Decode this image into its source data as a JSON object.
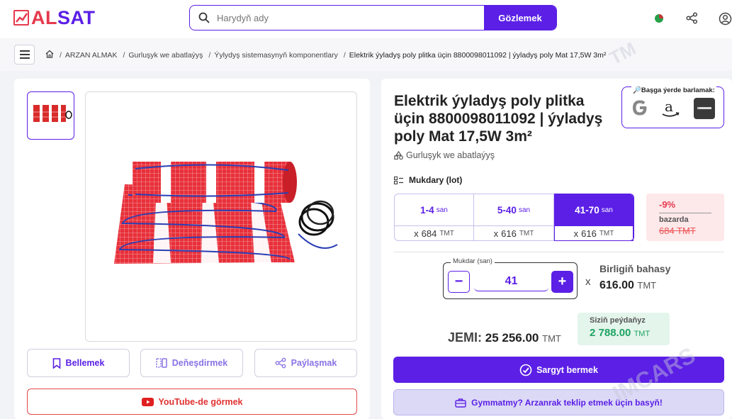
{
  "header": {
    "logo_text": "ALSAT",
    "search_placeholder": "Harydyň ady",
    "search_button": "Gözlemek"
  },
  "breadcrumb": {
    "items": [
      "ARZAN ALMAK",
      "Gurluşyk we abatlaýyş",
      "Ýylydyş sistemasynyň komponentlary"
    ],
    "current": "Elektrik ýyladyş poly plitka üçin 8800098011092 | ýyladyş poly Mat 17,5W 3m²"
  },
  "product": {
    "title": "Elektrik ýyladyş poly plitka üçin 8800098011092 | ýyladyş poly Mat 17,5W 3m²",
    "category": "Gurluşyk we abatlaýyş"
  },
  "compare": {
    "label": "🔎Başga ýerde barlamak:"
  },
  "actions": {
    "bookmark": "Bellemek",
    "compare": "Deňeşdirmek",
    "share": "Paýlaşmak",
    "youtube": "YouTube-de görmek"
  },
  "quantity": {
    "label": "Mukdary (lot)",
    "tiers": [
      {
        "range": "1-4",
        "unit": "san",
        "prefix": "x",
        "price": "684",
        "currency": "TMT"
      },
      {
        "range": "5-40",
        "unit": "san",
        "prefix": "x",
        "price": "616",
        "currency": "TMT"
      },
      {
        "range": "41-70",
        "unit": "san",
        "prefix": "x",
        "price": "616",
        "currency": "TMT"
      }
    ],
    "discount": {
      "percent": "-9%",
      "label": "bazarda",
      "old_price": "684 TMT"
    },
    "field_label": "Mukdar (san)",
    "value": "41",
    "minus": "−",
    "plus": "+",
    "times": "x",
    "unit_price_label": "Birligiň bahasy",
    "unit_price": "616.00",
    "currency": "TMT"
  },
  "summary": {
    "total_label": "JEMI:",
    "total": "25 256.00",
    "savings_label": "Siziň peýdaňyz",
    "savings": "2 788.00",
    "currency": "TMT"
  },
  "cta": {
    "order": "Sargyt bermek",
    "offer": "Gymmatmy? Arzanrak teklip etmek üçin basyň!"
  },
  "colors": {
    "accent": "#5b1fe6",
    "brand_red": "#e53a4e",
    "savings": "#1ea362"
  }
}
